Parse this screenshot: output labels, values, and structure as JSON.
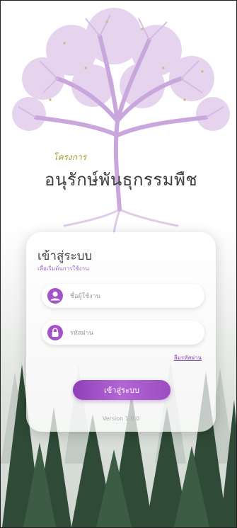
{
  "header": {
    "project_label": "โครงการ",
    "app_title": "อนุรักษ์พันธุกรรมพืช"
  },
  "login": {
    "title": "เข้าสู่ระบบ",
    "subtitle": "เพื่อเริ่มต้นการใช้งาน",
    "username_placeholder": "ชื่อผู้ใช้งาน",
    "password_placeholder": "รหัสผ่าน",
    "forgot_label": "ลืมรหัสผ่าน",
    "submit_label": "เข้าสู่ระบบ",
    "version_text": "Version 1.0.0"
  },
  "icons": {
    "user": "user-icon",
    "lock": "lock-icon"
  },
  "colors": {
    "accent": "#a352c9",
    "button_start": "#8e3fb8",
    "button_end": "#b267d4",
    "title_text": "#3d3d3d",
    "project_label": "#a89b32"
  }
}
